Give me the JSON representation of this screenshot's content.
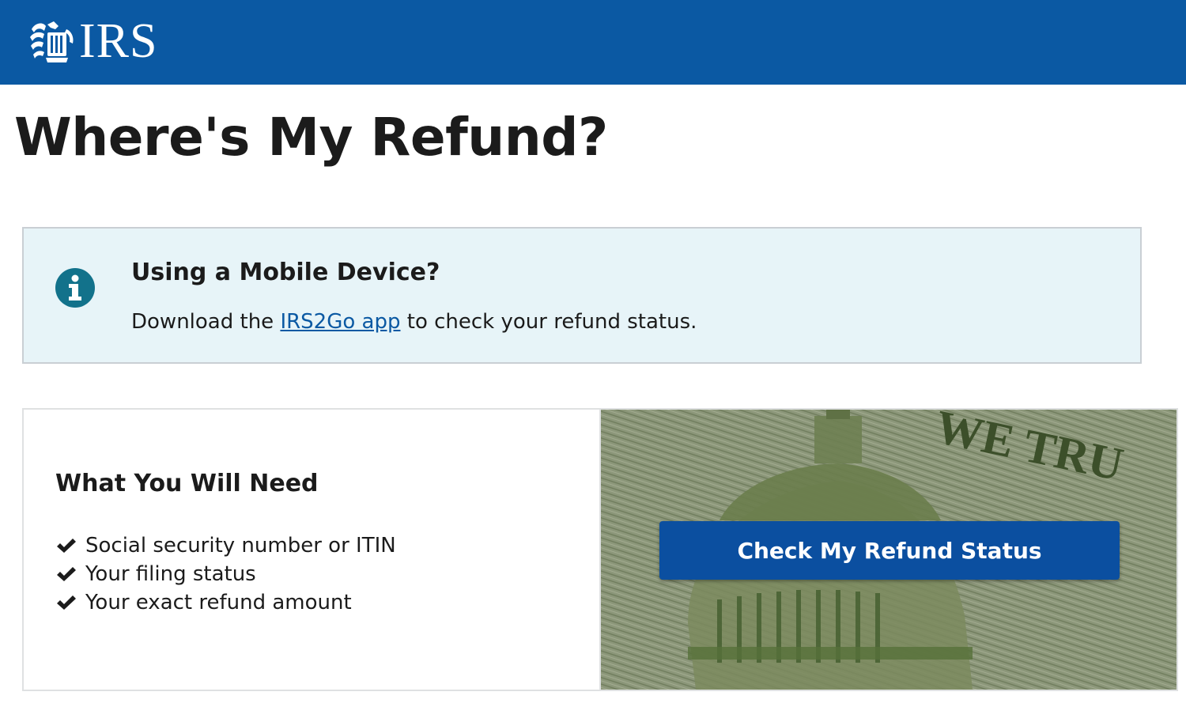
{
  "header": {
    "logo_text": "IRS",
    "logo_icon": "eagle-seal-icon",
    "background_color": "#0b59a3"
  },
  "page": {
    "title": "Where's My Refund?"
  },
  "alert": {
    "icon": "info-icon",
    "heading": "Using a Mobile Device?",
    "text_before": "Download the ",
    "link_text": "IRS2Go app",
    "text_after": " to check your refund status.",
    "background_color": "#e7f4f8"
  },
  "needs": {
    "heading": "What You Will Need",
    "items": [
      {
        "icon": "checkmark-icon",
        "label": "Social security number or ITIN"
      },
      {
        "icon": "checkmark-icon",
        "label": "Your filing status"
      },
      {
        "icon": "checkmark-icon",
        "label": "Your exact refund amount"
      }
    ]
  },
  "cta": {
    "label": "Check My Refund Status",
    "background_color": "#0b4fa0"
  },
  "banner_image": {
    "description_icon": "currency-capitol-dome-image",
    "engraved_text": "WE TRU"
  }
}
